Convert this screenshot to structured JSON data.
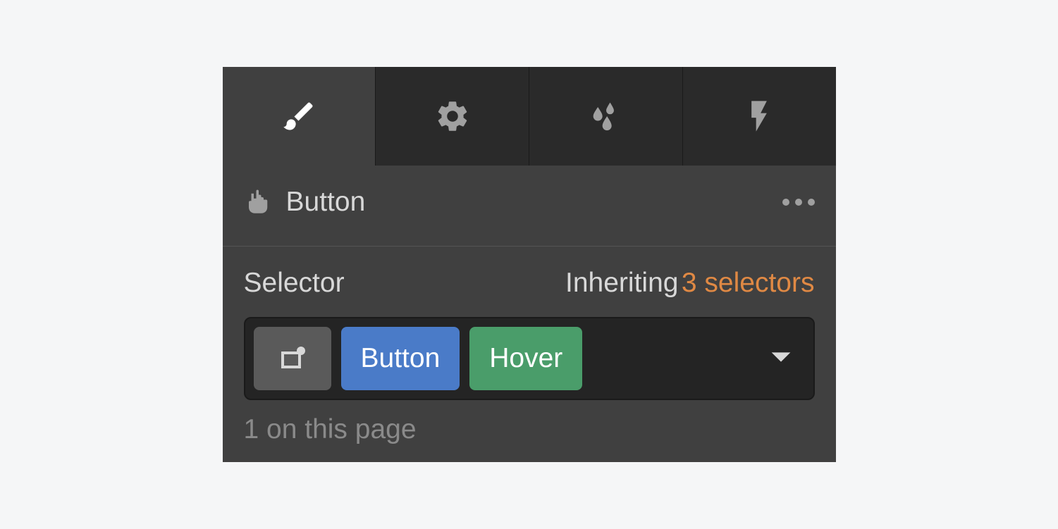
{
  "tabs": {
    "style": "brush-icon",
    "settings": "gear-icon",
    "effects": "droplets-icon",
    "interactions": "bolt-icon",
    "active": 0
  },
  "element": {
    "label": "Button"
  },
  "selector": {
    "title": "Selector",
    "inheriting_label": "Inheriting",
    "inheriting_count": "3 selectors",
    "class_chip": "Button",
    "state_chip": "Hover",
    "page_count": "1 on this page"
  }
}
